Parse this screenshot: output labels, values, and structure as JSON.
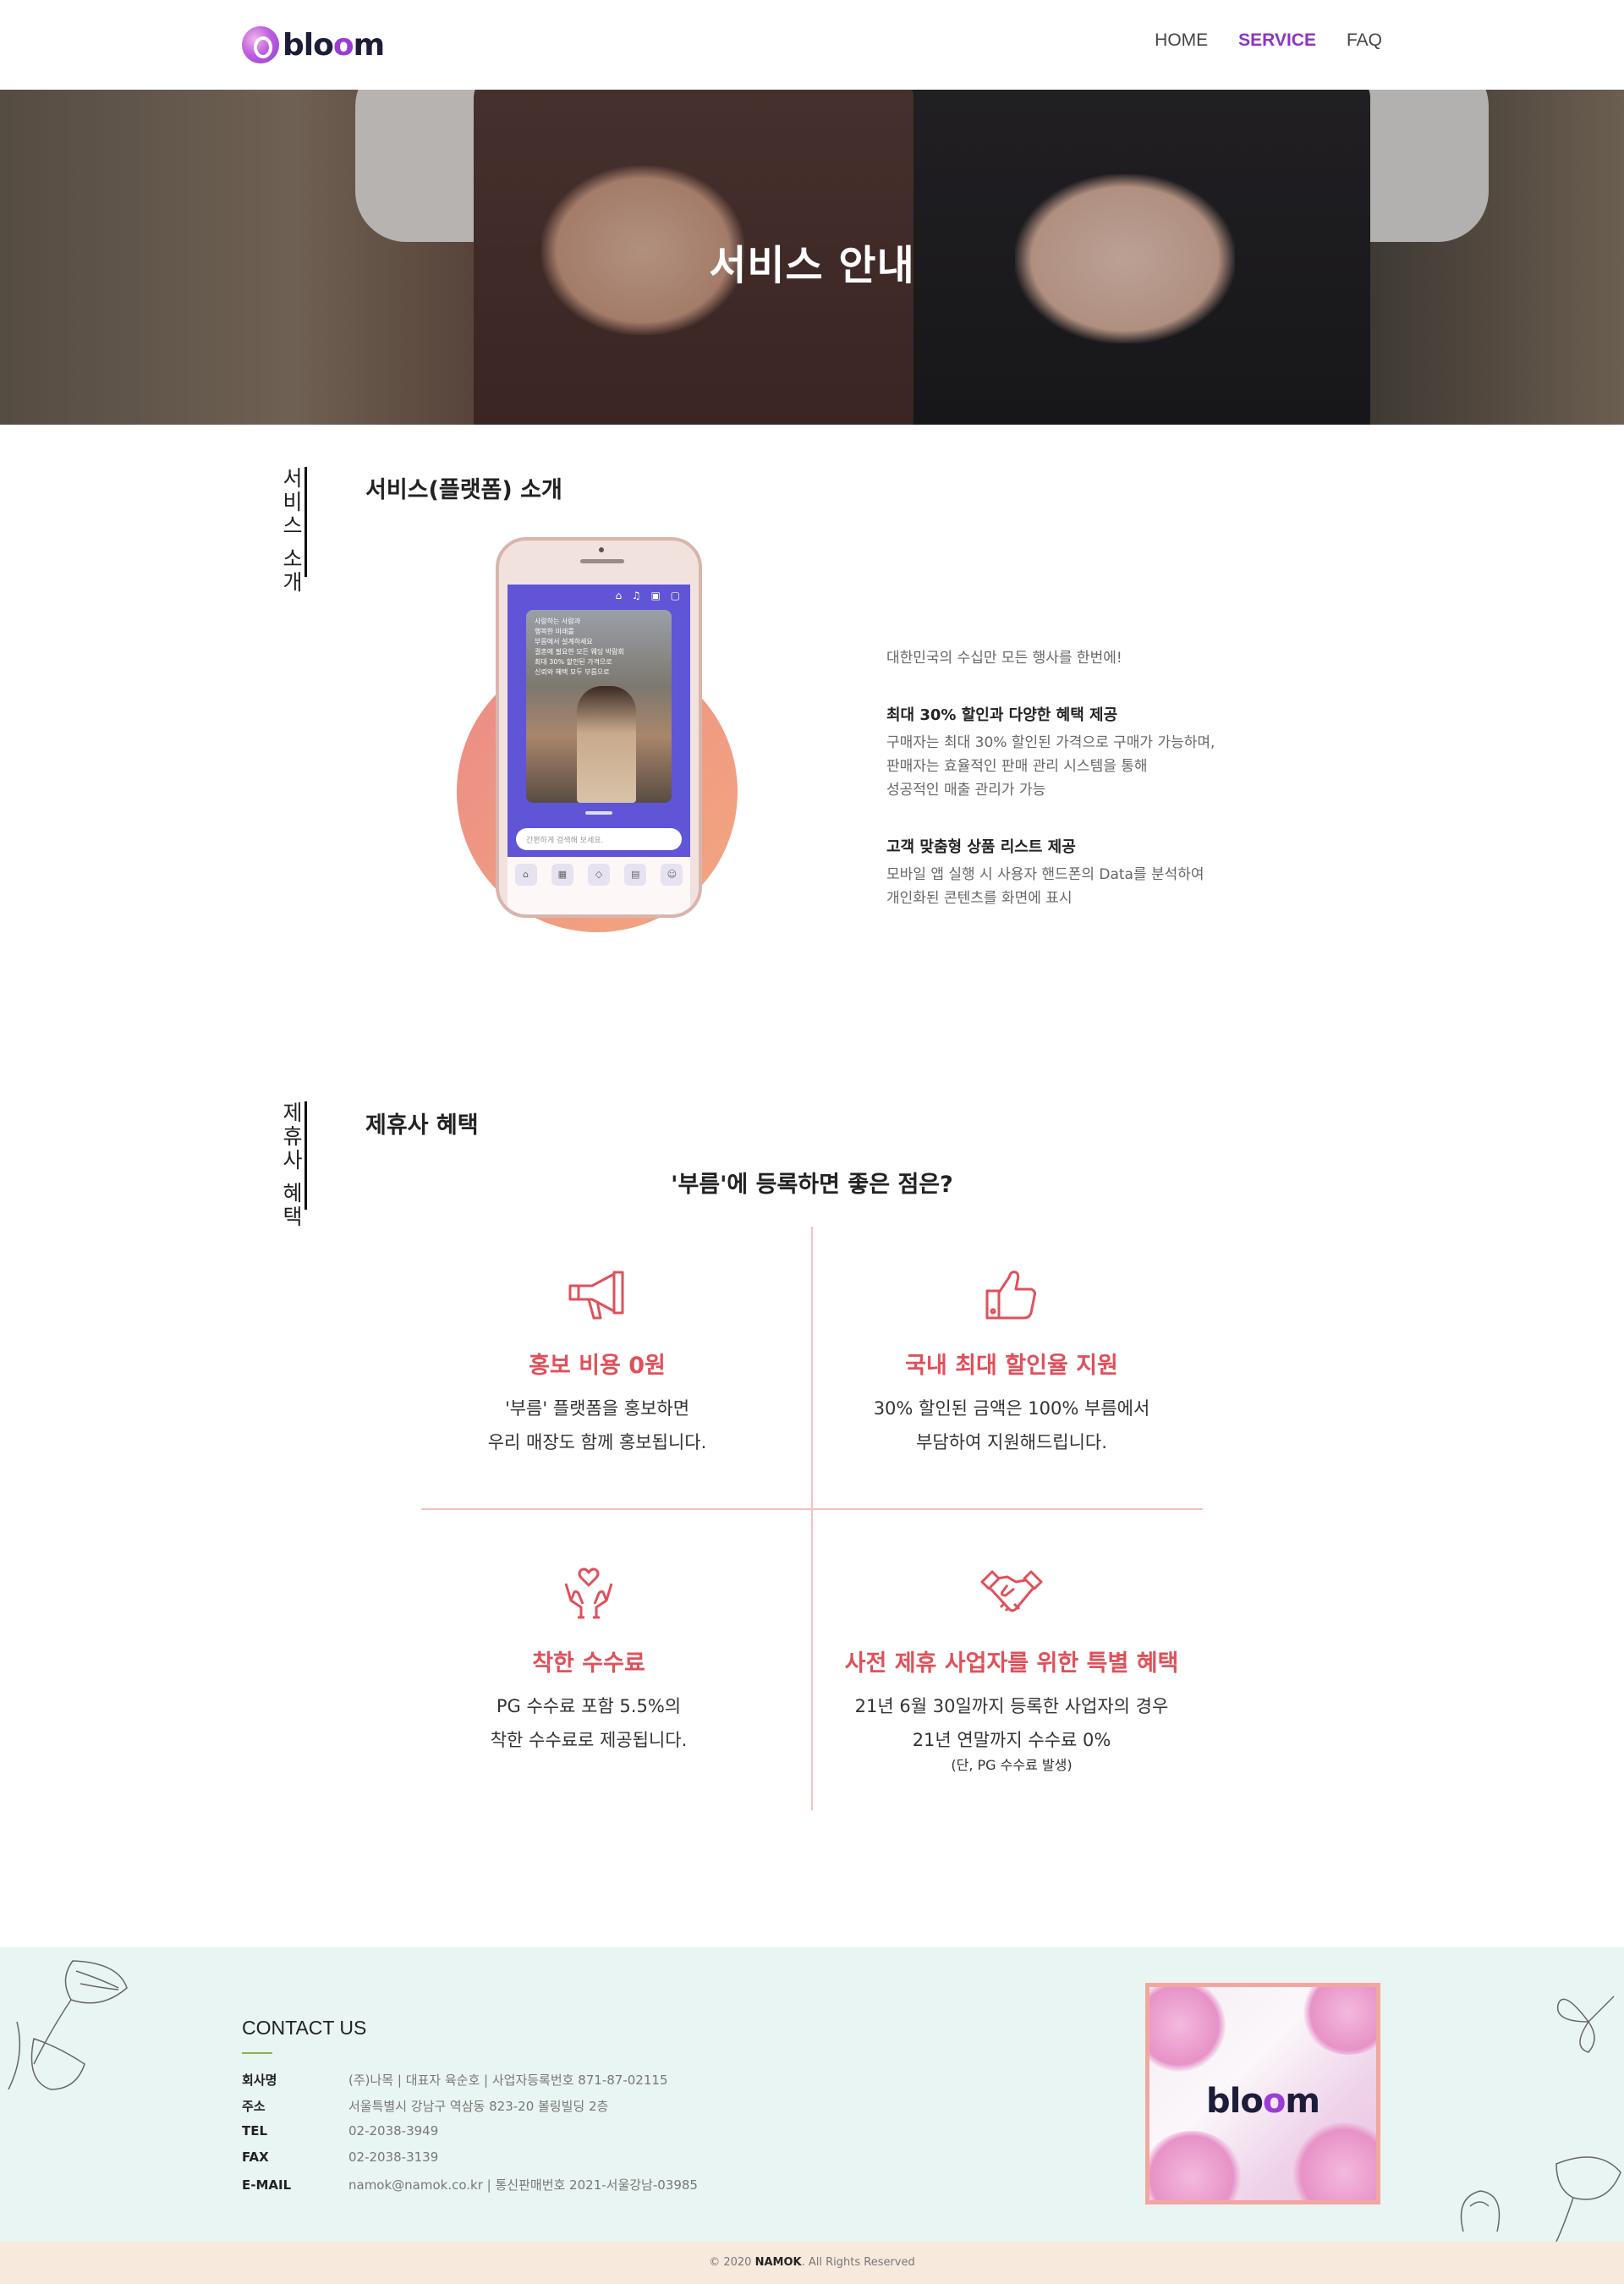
{
  "brand": {
    "logo_text_b": "b",
    "logo_text_l": "l",
    "logo_text_o1": "o",
    "logo_text_o2": "o",
    "logo_text_m": "m"
  },
  "nav": {
    "items": [
      {
        "label": "HOME",
        "active": false
      },
      {
        "label": "SERVICE",
        "active": true
      },
      {
        "label": "FAQ",
        "active": false
      }
    ]
  },
  "hero": {
    "title": "서비스 안내"
  },
  "intro": {
    "side_label": "서비스 소개",
    "title": "서비스(플랫폼) 소개",
    "phone": {
      "photo_lines": [
        "사랑하는 사람과",
        "행복한 미래를",
        "부름에서 설계하세요",
        "결혼에 필요한 모든 웨딩 박람회",
        "최대 30% 할인된 가격으로",
        "신뢰와 혜택 모두 부름으로"
      ],
      "search_placeholder": "간편하게 검색해 보세요."
    },
    "tagline": "대한민국의 수십만 모든 행사를 한번에!",
    "features": [
      {
        "heading": "최대 30% 할인과 다양한 혜택 제공",
        "lines": [
          "구매자는 최대 30% 할인된 가격으로 구매가 가능하며,",
          "판매자는 효율적인 판매 관리 시스템을 통해",
          "성공적인 매출 관리가 가능"
        ]
      },
      {
        "heading": "고객 맞춤형 상품 리스트 제공",
        "lines": [
          "모바일 앱 실행 시 사용자 핸드폰의 Data를 분석하여",
          "개인화된 콘텐츠를 화면에 표시"
        ]
      }
    ]
  },
  "benefits": {
    "side_label": "제휴사 혜택",
    "title": "제휴사 혜택",
    "subtitle": "'부름'에 등록하면 좋은 점은?",
    "accent_color": "#e0505a",
    "items": [
      {
        "icon": "megaphone-icon",
        "title": "홍보 비용 0원",
        "lines": [
          "'부름' 플랫폼을 홍보하면",
          "우리 매장도 함께 홍보됩니다."
        ],
        "note": ""
      },
      {
        "icon": "thumbs-up-icon",
        "title": "국내 최대 할인율 지원",
        "lines": [
          "30% 할인된 금액은 100% 부름에서",
          "부담하여 지원해드립니다."
        ],
        "note": ""
      },
      {
        "icon": "heart-hands-icon",
        "title": "착한 수수료",
        "lines": [
          "PG 수수료 포함 5.5%의",
          "착한 수수료로 제공됩니다."
        ],
        "note": ""
      },
      {
        "icon": "handshake-icon",
        "title": "사전 제휴 사업자를 위한 특별 혜택",
        "lines": [
          "21년 6월 30일까지 등록한 사업자의 경우",
          "21년 연말까지 수수료 0%"
        ],
        "note": "(단, PG 수수료 발생)"
      }
    ]
  },
  "footer": {
    "contact_title": "CONTACT US",
    "rows": [
      {
        "key": "회사명",
        "value": "(주)나목  |  대표자 육순호  |  사업자등록번호 871-87-02115"
      },
      {
        "key": "주소",
        "value": "서울특별시 강남구 역삼동 823-20 볼링빌딩 2층"
      },
      {
        "key": "TEL",
        "value": "02-2038-3949"
      },
      {
        "key": "FAX",
        "value": "02-2038-3139"
      },
      {
        "key": "E-MAIL",
        "value": "namok@namok.co.kr  |  통신판매번호 2021-서울강남-03985"
      }
    ],
    "copyright_prefix": "© 2020",
    "copyright_brand": "NAMOK",
    "copyright_suffix": ". All Rights Reserved"
  }
}
